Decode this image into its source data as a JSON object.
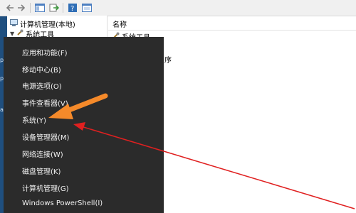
{
  "tree": {
    "root_label": "计算机管理(本地)",
    "child_label": "系统工具"
  },
  "list": {
    "header_name": "名称",
    "row_label": "系统工具",
    "partial_text": "序"
  },
  "menu": {
    "items": [
      {
        "label": "应用和功能(F)"
      },
      {
        "label": "移动中心(B)"
      },
      {
        "label": "电源选项(O)"
      },
      {
        "label": "事件查看器(V)"
      },
      {
        "label": "系统(Y)"
      },
      {
        "label": "设备管理器(M)"
      },
      {
        "label": "网络连接(W)"
      },
      {
        "label": "磁盘管理(K)"
      },
      {
        "label": "计算机管理(G)"
      },
      {
        "label": "Windows PowerShell(I)"
      }
    ]
  },
  "desktop_marks": [
    "p",
    "p",
    "a"
  ],
  "colors": {
    "menu_bg": "#2b2b2b",
    "orange_arrow": "#f58a2a",
    "red_arrow": "#e02020",
    "desktop_edge": "#1f4f7f"
  },
  "icons": [
    "back-arrow-icon",
    "forward-arrow-icon",
    "panel-icon",
    "export-icon",
    "help-icon",
    "window-icon",
    "computer-icon",
    "tools-icon"
  ]
}
